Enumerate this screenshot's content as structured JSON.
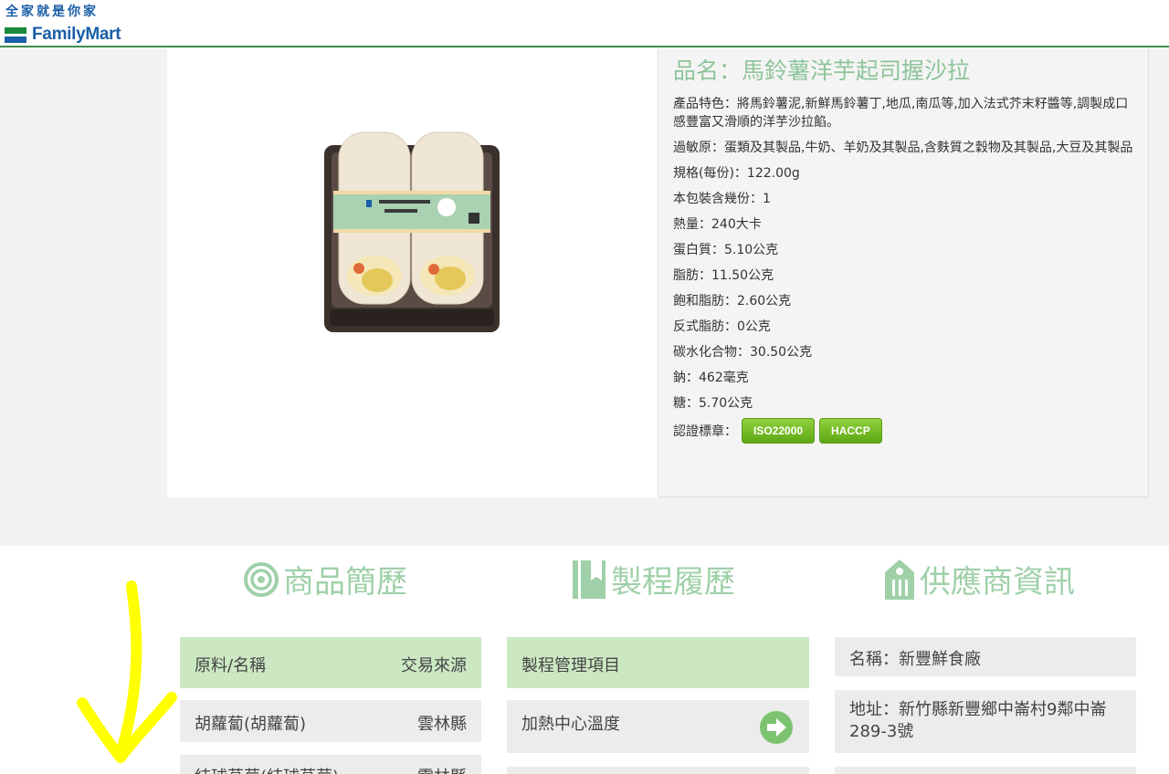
{
  "header": {
    "slogan": "全家就是你家",
    "logo_text": "FamilyMart",
    "brand_colors": {
      "green": "#1b8a3c",
      "blue": "#1a5fa8"
    }
  },
  "product": {
    "name": "品名：馬鈴薯洋芋起司握沙拉",
    "feature": "產品特色：將馬鈴薯泥,新鮮馬鈴薯丁,地瓜,南瓜等,加入法式芥末籽醬等,調製成口感豐富又滑順的洋芋沙拉餡。",
    "allergen": "過敏原：蛋類及其製品,牛奶、羊奶及其製品,含麩質之穀物及其製品,大豆及其製品",
    "spec": "規格(每份)：122.00g",
    "servings": "本包裝含幾份：1",
    "calories": "熱量：240大卡",
    "protein": "蛋白質：5.10公克",
    "fat": "脂肪：11.50公克",
    "sat_fat": "飽和脂肪：2.60公克",
    "trans_fat": "反式脂肪：0公克",
    "carbs": "碳水化合物：30.50公克",
    "sodium": "鈉：462毫克",
    "sugar": "糖：5.70公克",
    "cert_label": "認證標章：",
    "certs": [
      "ISO22000",
      "HACCP"
    ]
  },
  "sections": {
    "profile": {
      "title": "商品簡歷",
      "header_left": "原料/名稱",
      "header_right": "交易來源",
      "rows": [
        {
          "name": "胡蘿蔔(胡蘿蔔)",
          "source": "雲林縣"
        },
        {
          "name": "結球萵苣(結球萵苣)",
          "source": "雲林縣"
        }
      ]
    },
    "process": {
      "title": "製程履歷",
      "header": "製程管理項目",
      "rows": [
        "加熱中心溫度"
      ]
    },
    "supplier": {
      "title": "供應商資訊",
      "name": "名稱：新豐鮮食廠",
      "address": "地址：新竹縣新豐鄉中崙村9鄰中崙289-3號"
    }
  }
}
